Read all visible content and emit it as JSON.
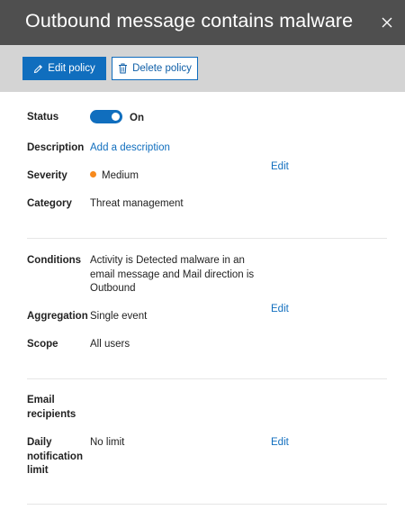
{
  "header": {
    "title": "Outbound message contains malware",
    "close_icon": "close-icon"
  },
  "toolbar": {
    "edit_label": "Edit policy",
    "edit_icon": "pencil-icon",
    "delete_label": "Delete policy",
    "delete_icon": "trash-icon"
  },
  "details": {
    "status_label": "Status",
    "status_value": "On",
    "description_label": "Description",
    "description_link": "Add a description",
    "severity_label": "Severity",
    "severity_value": "Medium",
    "severity_color": "#f7891c",
    "category_label": "Category",
    "category_value": "Threat management",
    "edit_label": "Edit"
  },
  "conditions": {
    "conditions_label": "Conditions",
    "conditions_value": "Activity is Detected malware in an email message and Mail direction is Outbound",
    "aggregation_label": "Aggregation",
    "aggregation_value": "Single event",
    "scope_label": "Scope",
    "scope_value": "All users",
    "edit_label": "Edit"
  },
  "notifications": {
    "email_label": "Email recipients",
    "limit_label": "Daily notification limit",
    "limit_value": "No limit",
    "edit_label": "Edit"
  },
  "colors": {
    "accent": "#106ebe",
    "header_bg": "#4f4f4f",
    "toolbar_bg": "#d4d4d4"
  }
}
